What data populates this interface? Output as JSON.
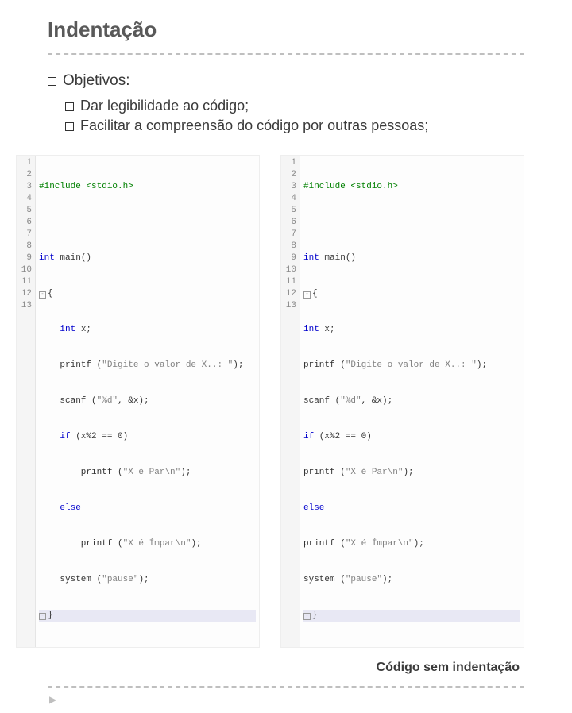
{
  "title": "Indentação",
  "bullets": {
    "l1": "Objetivos:",
    "l2a": "Dar legibilidade ao código;",
    "l2b": "Facilitar a compreensão do código por outras pessoas;"
  },
  "code_left": {
    "lines": [
      "#include <stdio.h>",
      "",
      "int main()",
      "{",
      "    int x;",
      "    printf (\"Digite o valor de X..: \");",
      "    scanf (\"%d\", &x);",
      "    if (x%2 == 0)",
      "        printf (\"X é Par\\n\");",
      "    else",
      "        printf (\"X é Ímpar\\n\");",
      "    system (\"pause\");",
      "}"
    ],
    "numbers": [
      "1",
      "2",
      "3",
      "4",
      "5",
      "6",
      "7",
      "8",
      "9",
      "10",
      "11",
      "12",
      "13"
    ]
  },
  "code_right": {
    "lines": [
      "#include <stdio.h>",
      "",
      "int main()",
      "{",
      "int x;",
      "printf (\"Digite o valor de X..: \");",
      "scanf (\"%d\", &x);",
      "if (x%2 == 0)",
      "printf (\"X é Par\\n\");",
      "else",
      "printf (\"X é Ímpar\\n\");",
      "system (\"pause\");",
      "}"
    ],
    "numbers": [
      "1",
      "2",
      "3",
      "4",
      "5",
      "6",
      "7",
      "8",
      "9",
      "10",
      "11",
      "12",
      "13"
    ]
  },
  "caption": "Código sem indentação",
  "arrow": "▶"
}
